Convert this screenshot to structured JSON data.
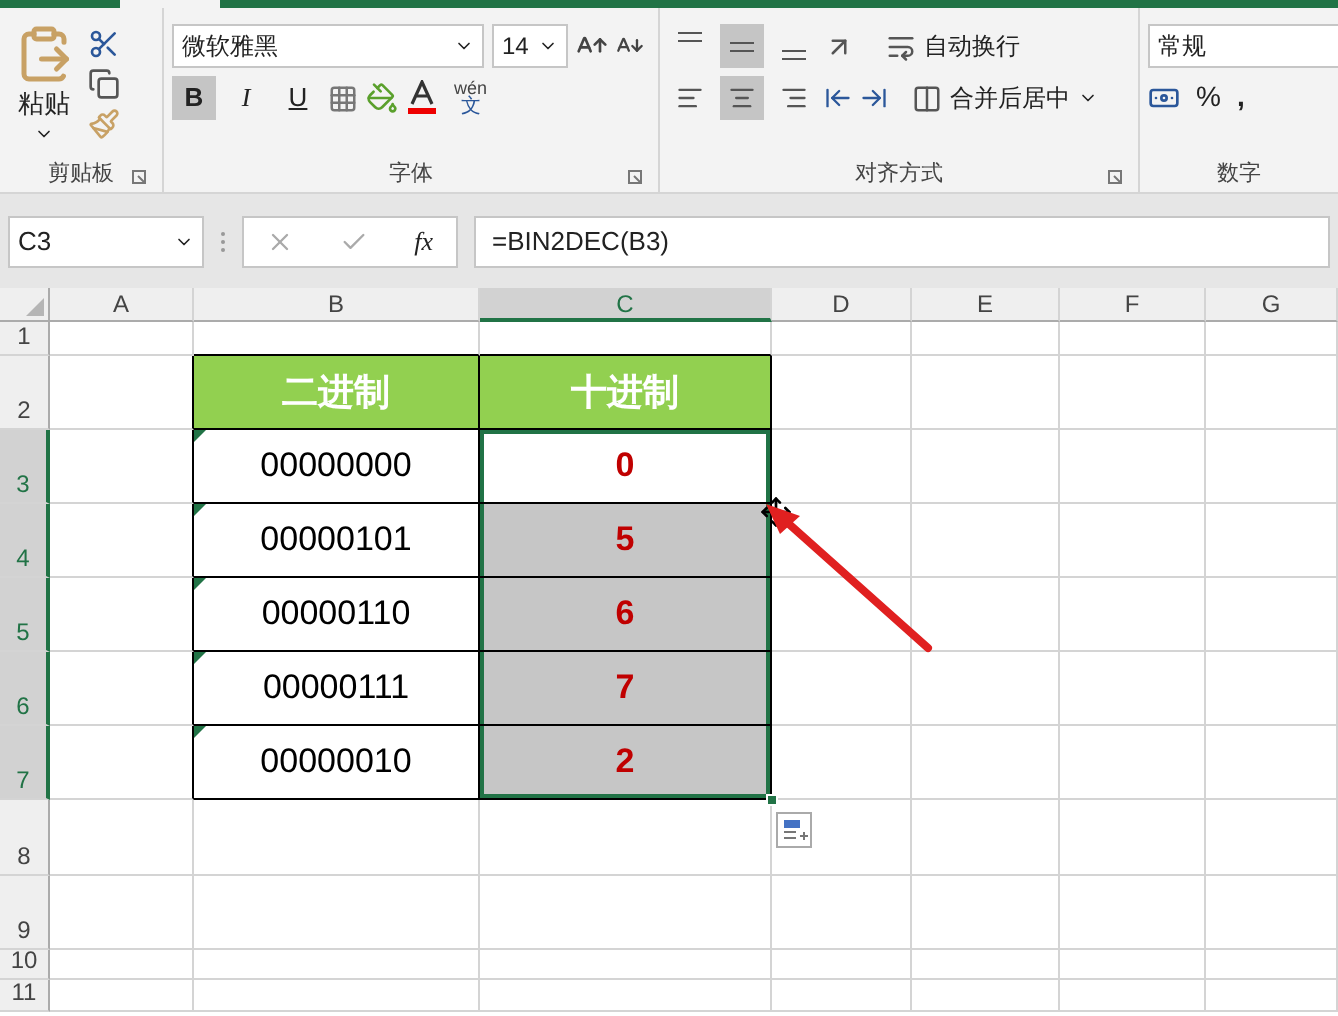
{
  "ribbon": {
    "clipboard": {
      "paste": "粘贴",
      "label": "剪贴板"
    },
    "font": {
      "name": "微软雅黑",
      "size": "14",
      "styles": [
        {
          "label": "B",
          "kind": "bold",
          "selected": true
        },
        {
          "label": "I",
          "kind": "italic",
          "selected": false
        },
        {
          "label": "U",
          "kind": "underline",
          "selected": false
        }
      ],
      "phonetic_top": "wén",
      "phonetic_bottom": "文",
      "label": "字体"
    },
    "alignment": {
      "vertical": [
        {
          "kind": "top",
          "selected": false
        },
        {
          "kind": "middle",
          "selected": true
        },
        {
          "kind": "bottom",
          "selected": false
        }
      ],
      "horizontal": [
        {
          "kind": "left",
          "selected": false
        },
        {
          "kind": "center",
          "selected": true
        },
        {
          "kind": "right",
          "selected": false
        }
      ],
      "wrap": "自动换行",
      "merge": "合并后居中",
      "label": "对齐方式"
    },
    "number": {
      "format": "常规",
      "percent": "%",
      "comma": ",",
      "label": "数字"
    }
  },
  "formula_bar": {
    "name_box": "C3",
    "function_label": "fx",
    "formula": "=BIN2DEC(B3)"
  },
  "columns": [
    {
      "label": "A",
      "selected": false
    },
    {
      "label": "B",
      "selected": false
    },
    {
      "label": "C",
      "selected": true
    },
    {
      "label": "D",
      "selected": false
    },
    {
      "label": "E",
      "selected": false
    },
    {
      "label": "F",
      "selected": false
    },
    {
      "label": "G",
      "selected": false
    }
  ],
  "row_headers": [
    {
      "label": "1",
      "selected": false
    },
    {
      "label": "2",
      "selected": false
    },
    {
      "label": "3",
      "selected": true
    },
    {
      "label": "4",
      "selected": true
    },
    {
      "label": "5",
      "selected": true
    },
    {
      "label": "6",
      "selected": true
    },
    {
      "label": "7",
      "selected": true
    },
    {
      "label": "8",
      "selected": false
    },
    {
      "label": "9",
      "selected": false
    },
    {
      "label": "10",
      "selected": false
    },
    {
      "label": "11",
      "selected": false
    }
  ],
  "table": {
    "headers": [
      "二进制",
      "十进制"
    ],
    "rows": [
      {
        "binary": "00000000",
        "decimal": "0",
        "selected": true,
        "active": true
      },
      {
        "binary": "00000101",
        "decimal": "5",
        "selected": true,
        "active": false
      },
      {
        "binary": "00000110",
        "decimal": "6",
        "selected": true,
        "active": false
      },
      {
        "binary": "00000111",
        "decimal": "7",
        "selected": true,
        "active": false
      },
      {
        "binary": "00000010",
        "decimal": "2",
        "selected": true,
        "active": false
      }
    ]
  }
}
